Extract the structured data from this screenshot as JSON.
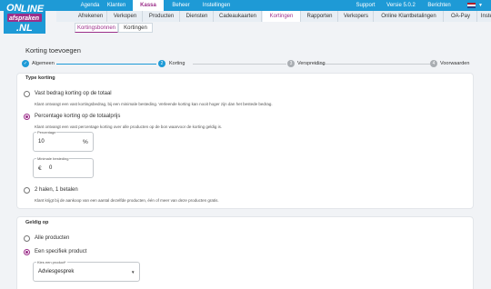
{
  "brand": {
    "logo_text": [
      "ON",
      "LINE",
      "afspraken",
      ".NL"
    ],
    "primary_color": "#1e9ad6",
    "accent_color": "#9c2f8a"
  },
  "topnav": {
    "items": [
      {
        "label": "Agenda"
      },
      {
        "label": "Klanten"
      },
      {
        "label": "Kassa",
        "active": true
      },
      {
        "label": "Beheer"
      },
      {
        "label": "Instellingen"
      }
    ],
    "right": {
      "support": "Support",
      "version": "Versie 5.0.2",
      "messages": "Berichten"
    }
  },
  "subnav": {
    "items": [
      {
        "label": "Afrekenen"
      },
      {
        "label": "Verkopen"
      },
      {
        "label": "Producten"
      },
      {
        "label": "Diensten"
      },
      {
        "label": "Cadeaukaarten"
      },
      {
        "label": "Kortingen",
        "active": true
      },
      {
        "label": "Rapporten"
      },
      {
        "label": "Verkopers"
      },
      {
        "label": "Online Klantbetalingen"
      },
      {
        "label": "OA-Pay"
      },
      {
        "label": "Instel"
      }
    ]
  },
  "subnav2": {
    "items": [
      {
        "label": "Kortingsbonnen",
        "active": true
      },
      {
        "label": "Kortingen"
      }
    ]
  },
  "page": {
    "title": "Korting toevoegen"
  },
  "stepper": {
    "steps": [
      {
        "num": "",
        "label": "Algemeen",
        "state": "done"
      },
      {
        "num": "2",
        "label": "Korting",
        "state": "current"
      },
      {
        "num": "3",
        "label": "Verspreiding",
        "state": "todo"
      },
      {
        "num": "4",
        "label": "Voorwaarden",
        "state": "todo"
      }
    ]
  },
  "type_korting": {
    "title": "Type korting",
    "options": [
      {
        "label": "Vast bedrag korting op de totaal",
        "desc": "Klant ontvangt een vast kortingsbedrag, bij een minimale besteding. Verleende korting kan nooit hoger zijn dan het bestede bedrag.",
        "selected": false
      },
      {
        "label": "Percentage korting op de totaalprijs",
        "desc": "Klant ontvangt een vast percentage korting over alle producten op de bon waarvoor de korting geldig is.",
        "selected": true
      },
      {
        "label": "2 halen, 1 betalen",
        "desc": "Klant krijgt bij de aankoop van een aantal dezelfde producten, één of meer van deze producten gratis.",
        "selected": false
      }
    ],
    "percentage": {
      "label": "Percentage",
      "value": "10",
      "suffix": "%"
    },
    "minimum": {
      "label": "Minimale besteding",
      "prefix": "€",
      "value": "0"
    }
  },
  "geldig_op": {
    "title": "Geldig op",
    "options": [
      {
        "label": "Alle producten",
        "selected": false
      },
      {
        "label": "Een specifiek product",
        "selected": true
      }
    ],
    "product_select": {
      "label": "Kies een product*",
      "value": "Adviesgesprek"
    }
  }
}
